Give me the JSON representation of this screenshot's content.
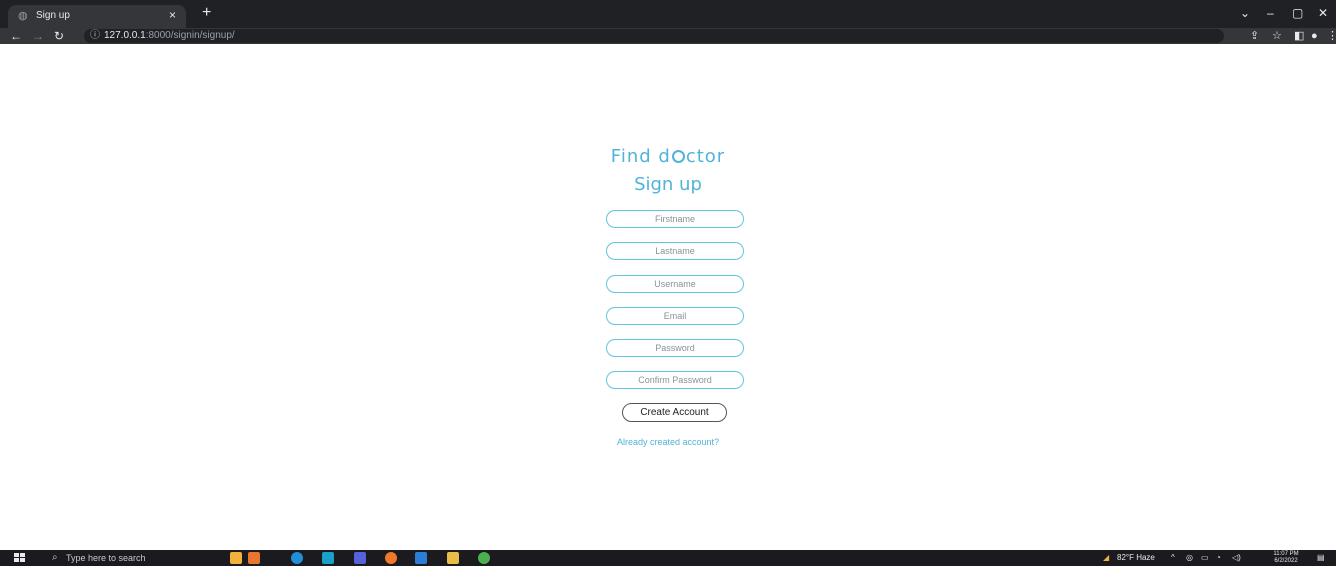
{
  "browser": {
    "tab_title": "Sign up",
    "tab_close": "×",
    "new_tab": "+",
    "url_host": "127.0.0.1",
    "url_path": ":8000/signin/signup/",
    "icons": [
      "globe-icon",
      "close-icon",
      "plus-icon",
      "chevron-down-icon",
      "minimize-icon",
      "restore-icon",
      "close-window-icon",
      "back-icon",
      "forward-icon",
      "reload-icon",
      "info-icon",
      "share-icon",
      "star-icon",
      "sidebar-icon",
      "profile-icon",
      "menu-icon"
    ]
  },
  "page": {
    "brand": {
      "part1": "Find d",
      "part2": "ctor"
    },
    "heading": "Sign up",
    "fields": {
      "firstname": "Firstname",
      "lastname": "Lastname",
      "username": "Username",
      "email": "Email",
      "password": "Password",
      "confirm": "Confirm Password"
    },
    "create_button": "Create Account",
    "login_link": "Already created account?",
    "accent_color": "#4fb4d8"
  },
  "taskbar": {
    "search_placeholder": "Type here to search",
    "weather": "82°F  Haze",
    "time": "11:07 PM",
    "date": "6/2/2022"
  }
}
